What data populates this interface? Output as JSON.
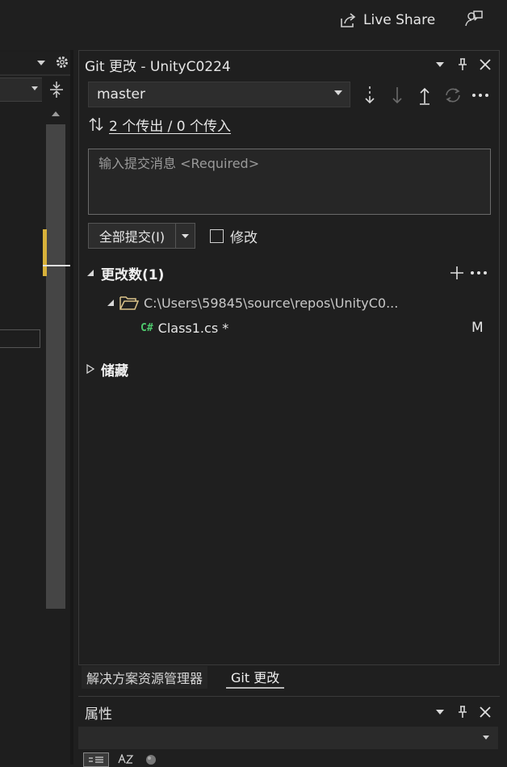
{
  "topbar": {
    "live_share_label": "Live Share"
  },
  "git_panel": {
    "title": "Git 更改 - UnityC0224",
    "branch": "master",
    "outgoing_incoming": "2 个传出 / 0 个传入",
    "commit_placeholder": "输入提交消息 <Required>",
    "commit_all_label": "全部提交(I)",
    "amend_label": "修改",
    "changes_header": "更改数(1)",
    "folder_path": "C:\\Users\\59845\\source\\repos\\UnityC0...",
    "file_name": "Class1.cs *",
    "file_lang_badge": "C#",
    "file_status": "M",
    "stashes_header": "储藏"
  },
  "tabs": [
    {
      "label": "解决方案资源管理器",
      "active": false
    },
    {
      "label": "Git 更改",
      "active": true
    }
  ],
  "properties": {
    "title": "属性"
  },
  "colors": {
    "accent_yellow": "#d8b13a",
    "csharp_green": "#4ec96d",
    "folder_tan": "#dcc48a"
  }
}
